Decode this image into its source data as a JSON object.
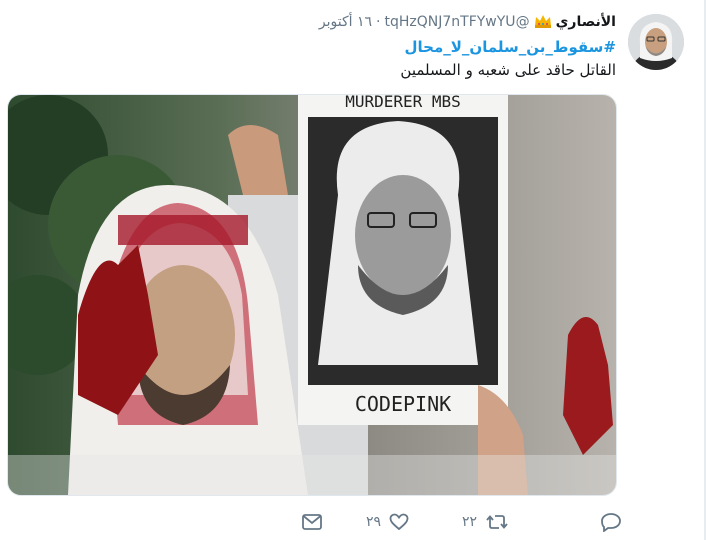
{
  "tweet": {
    "display_name": "الأنصاري",
    "handle": "@tqHzQNJ7nTFYwYU",
    "date": "١٦ أكتوبر",
    "hashtag": "#سقوط_بن_سلمان_لا_محال",
    "text": "القاتل حاقد على شعبه و المسلمين",
    "media": {
      "sign_top_text": "MURDERER MBS",
      "sign_bottom_text": "CODEPINK"
    },
    "actions": {
      "reply_count": "",
      "retweet_count": "٢٢",
      "like_count": "٢٩"
    }
  },
  "icons": {
    "crown": "crown-icon",
    "reply": "reply-icon",
    "retweet": "retweet-icon",
    "like": "heart-icon",
    "dm": "envelope-icon"
  },
  "colors": {
    "link": "#1b95e0",
    "muted": "#657786",
    "crown": "#f5b400"
  }
}
